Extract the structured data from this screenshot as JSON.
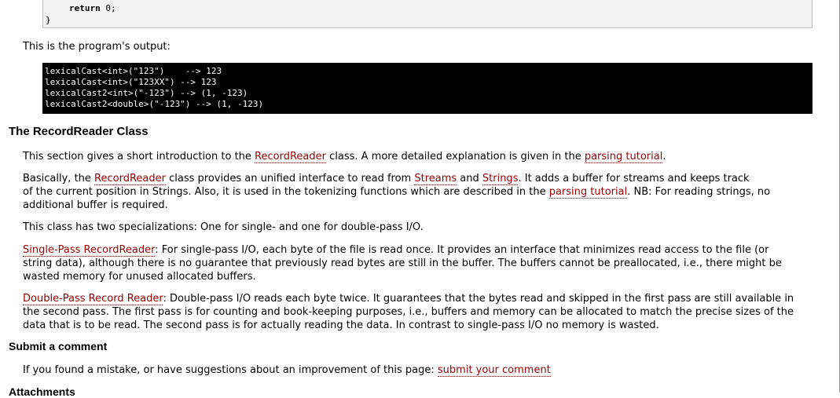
{
  "code_tail": {
    "return_kw": "return",
    "return_rest": " 0;",
    "close_brace": "}"
  },
  "output_intro": "This is the program's output:",
  "output_lines": [
    "lexicalCast<int>(\"123\")    --> 123",
    "lexicalCast<int>(\"123XX\") --> 123",
    "lexicalCast2<int>(\"-123\") --> (1, -123)",
    "lexicalCast2<double>(\"-123\") --> (1, -123)"
  ],
  "section_recordreader": {
    "heading": "The RecordReader Class",
    "p1": {
      "t1": "This section gives a short introduction to the ",
      "link1": "RecordReader",
      "t2": " class. A more detailed explanation is given in the ",
      "link2": "parsing tutorial",
      "t3": "."
    },
    "p2": {
      "t1": "Basically, the ",
      "link1": "RecordReader",
      "t2": " class provides an unified interface to read from ",
      "link2": "Streams",
      "t3": " and ",
      "link3": "Strings",
      "t4": ". It adds a buffer for streams and keeps track",
      "t5": "of the current position in Strings. Also, it is used in the tokenizing functions which are described in the ",
      "link4": "parsing tutorial",
      "t6": ". NB: For reading strings, no",
      "t7": "additional buffer is required."
    },
    "p3": "This class has two specializations: One for single- and one for double-pass I/O.",
    "p4": {
      "link": "Single-Pass RecordReader",
      "line1": ": For single-pass I/O, each byte of the file is read once. It provides an interface that minimizes read access to the file (or",
      "line2": "string data), although there is no guarantee that previously read bytes are still in the buffer. The buffers cannot be preallocated, i.e., there might be",
      "line3": "wasted memory for unused allocated buffers."
    },
    "p5": {
      "link": "Double-Pass Record Reader",
      "line1": ": Double-pass I/O reads each byte twice. It guarantees that the bytes read and skipped in the first pass are still available in",
      "line2": "the second pass. The first pass is for counting and book-keeping purposes, i.e., buffers and memory can be allocated to match the precise sizes of the",
      "line3": "data that is to be read. The second pass is for actually reading the data. In contrast to single-pass I/O no memory is wasted."
    }
  },
  "section_comment": {
    "heading": "Submit a comment",
    "text": "If you found a mistake, or have suggestions about an improvement of this page: ",
    "link": "submit your comment"
  },
  "section_attachments": {
    "heading": "Attachments"
  }
}
